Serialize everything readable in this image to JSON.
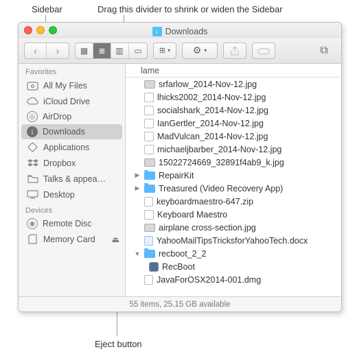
{
  "annotations": {
    "sidebar": "Sidebar",
    "divider": "Drag this divider to shrink or widen the Sidebar",
    "eject": "Eject button"
  },
  "window": {
    "title": "Downloads",
    "traffic": {
      "close": "#ff5f57",
      "minimize": "#ffbd2e",
      "zoom": "#28c940"
    }
  },
  "toolbar": {
    "back": "‹",
    "forward": "›",
    "view_icon": "▦",
    "view_list": "≣",
    "view_columns": "|||",
    "view_cover": "≡",
    "arrange": "⊞",
    "arrange_caret": "▾",
    "action_gear": "⚙",
    "action_caret": "▾",
    "share": "⇪",
    "tags": "◯",
    "dropbox": "⧈"
  },
  "sidebar": {
    "sections": {
      "favorites": "Favorites",
      "devices": "Devices"
    },
    "favorites": [
      {
        "name": "all-my-files",
        "label": "All My Files"
      },
      {
        "name": "icloud-drive",
        "label": "iCloud Drive"
      },
      {
        "name": "airdrop",
        "label": "AirDrop"
      },
      {
        "name": "downloads",
        "label": "Downloads",
        "selected": true
      },
      {
        "name": "applications",
        "label": "Applications"
      },
      {
        "name": "dropbox",
        "label": "Dropbox"
      },
      {
        "name": "talks",
        "label": "Talks & appea…"
      },
      {
        "name": "desktop",
        "label": "Desktop"
      }
    ],
    "devices": [
      {
        "name": "remote-disc",
        "label": "Remote Disc"
      },
      {
        "name": "memory-card",
        "label": "Memory Card",
        "eject": true
      }
    ],
    "eject_glyph": "⏏"
  },
  "list": {
    "header_name": "lame",
    "items": [
      {
        "icon": "pic",
        "label": "srfarlow_2014-Nov-12.jpg"
      },
      {
        "icon": "jpg",
        "label": "lhicks2002_2014-Nov-12.jpg"
      },
      {
        "icon": "jpg",
        "label": "socialshark_2014-Nov-12.jpg"
      },
      {
        "icon": "jpg",
        "label": "IanGertler_2014-Nov-12.jpg"
      },
      {
        "icon": "jpg",
        "label": "MadVulcan_2014-Nov-12.jpg"
      },
      {
        "icon": "jpg",
        "label": "michaeljbarber_2014-Nov-12.jpg"
      },
      {
        "icon": "pic",
        "label": "15022724669_32891f4ab9_k.jpg"
      },
      {
        "icon": "folder-blue",
        "disclosure": "▶",
        "label": "RepairKit"
      },
      {
        "icon": "folder-blue",
        "disclosure": "▶",
        "label": "Treasured (Video Recovery App)"
      },
      {
        "icon": "zip",
        "label": "keyboardmaestro-647.zip"
      },
      {
        "icon": "km",
        "label": "Keyboard Maestro"
      },
      {
        "icon": "pic",
        "label": "airplane cross-section.jpg"
      },
      {
        "icon": "docx",
        "label": "YahooMailTipsTricksforYahooTech.docx"
      },
      {
        "icon": "folder-blue",
        "disclosure": "▼",
        "label": "recboot_2_2"
      },
      {
        "icon": "app",
        "depth": 1,
        "label": "RecBoot"
      },
      {
        "icon": "dmg",
        "label": "JavaForOSX2014-001.dmg"
      }
    ]
  },
  "status": "55 items, 25.15 GB available"
}
